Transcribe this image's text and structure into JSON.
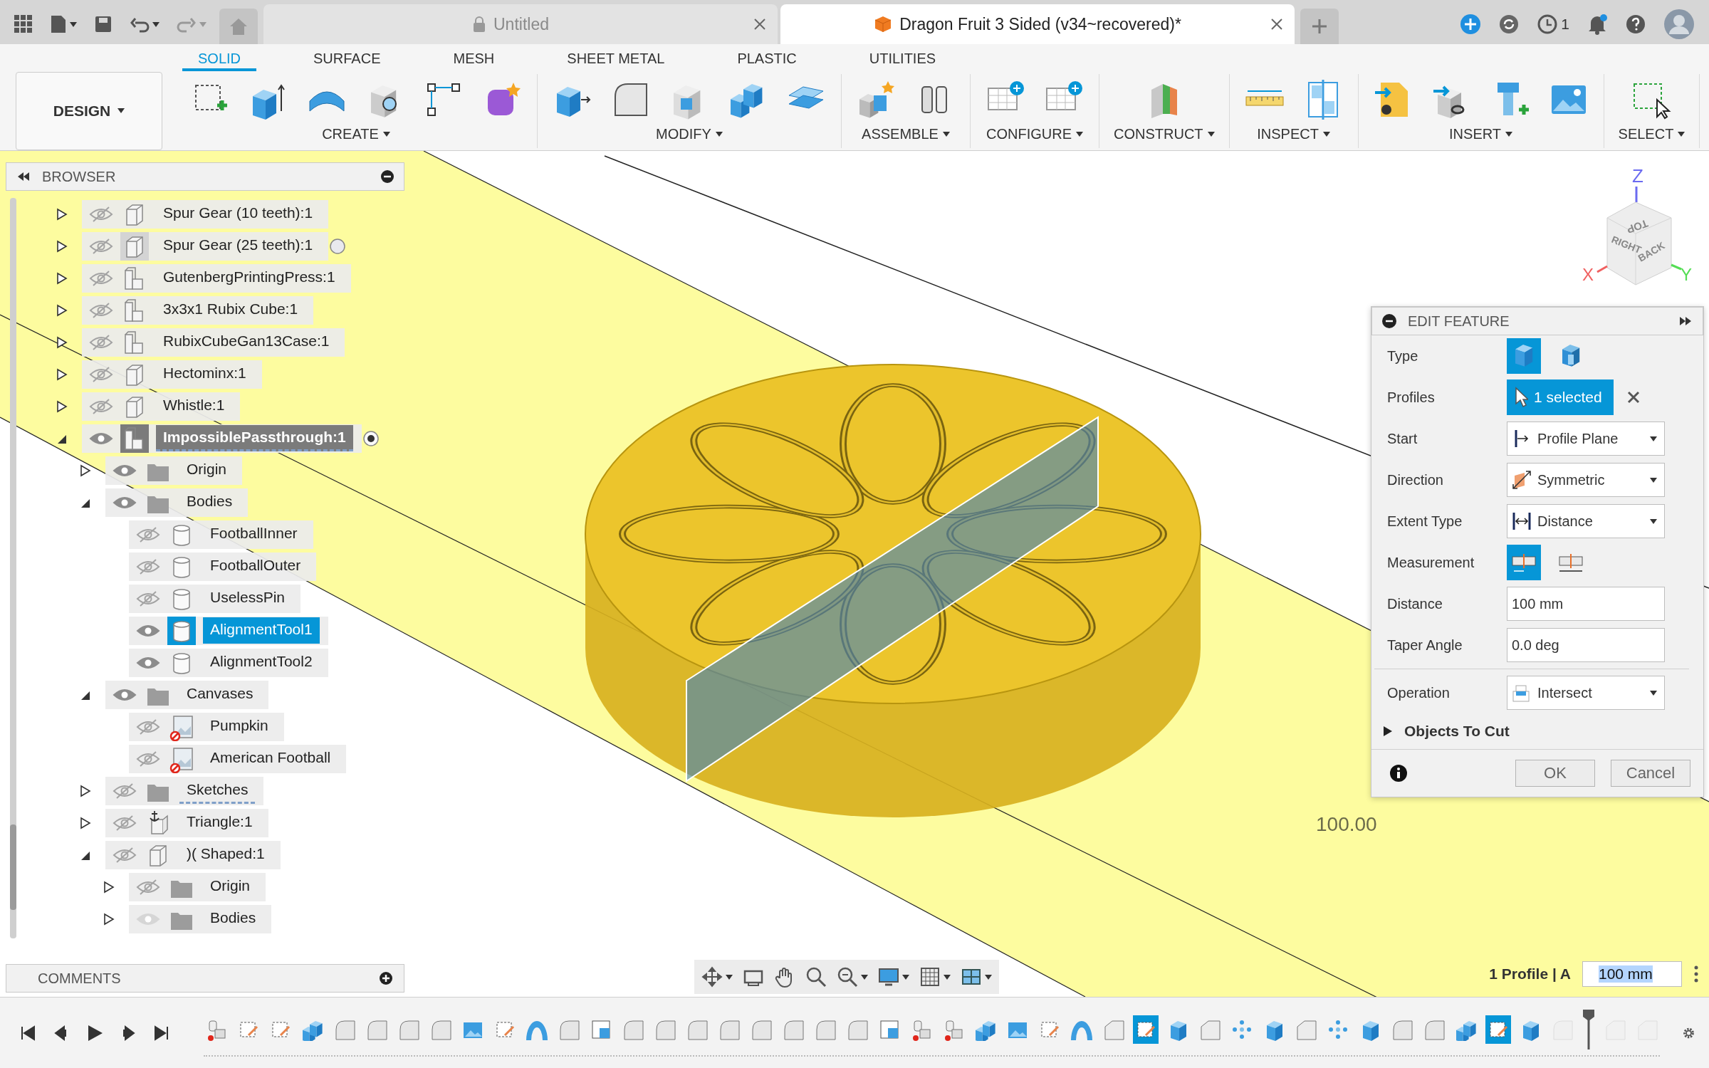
{
  "title_bar": {
    "tabs": [
      {
        "label": "Untitled",
        "selected": false,
        "locked": true
      },
      {
        "label": "Dragon Fruit 3 Sided (v34~recovered)*",
        "selected": true,
        "locked": false
      }
    ],
    "jobs_count": "1",
    "notification_dot": true
  },
  "workspace": {
    "label": "DESIGN"
  },
  "ribbon_tabs": [
    {
      "label": "SOLID",
      "selected": true
    },
    {
      "label": "SURFACE",
      "selected": false
    },
    {
      "label": "MESH",
      "selected": false
    },
    {
      "label": "SHEET METAL",
      "selected": false
    },
    {
      "label": "PLASTIC",
      "selected": false
    },
    {
      "label": "UTILITIES",
      "selected": false
    }
  ],
  "tool_groups": [
    {
      "label": "CREATE"
    },
    {
      "label": "MODIFY"
    },
    {
      "label": "ASSEMBLE"
    },
    {
      "label": "CONFIGURE"
    },
    {
      "label": "CONSTRUCT"
    },
    {
      "label": "INSPECT"
    },
    {
      "label": "INSERT"
    },
    {
      "label": "SELECT"
    }
  ],
  "browser": {
    "title": "BROWSER",
    "items": [
      {
        "label": "Spur Gear (10 teeth):1",
        "kind": "part",
        "visible": false,
        "expanded": false,
        "selected": false
      },
      {
        "label": "Spur Gear (25 teeth):1",
        "kind": "part",
        "visible": false,
        "expanded": false,
        "selected": false,
        "hovered": true,
        "activated": false
      },
      {
        "label": "GutenbergPrintingPress:1",
        "kind": "assembly",
        "visible": false,
        "expanded": false,
        "selected": false
      },
      {
        "label": "3x3x1 Rubix Cube:1",
        "kind": "assembly",
        "visible": false,
        "expanded": false,
        "selected": false
      },
      {
        "label": "RubixCubeGan13Case:1",
        "kind": "assembly",
        "visible": false,
        "expanded": false,
        "selected": false
      },
      {
        "label": "Hectominx:1",
        "kind": "part",
        "visible": false,
        "expanded": false,
        "selected": false
      },
      {
        "label": "Whistle:1",
        "kind": "part",
        "visible": false,
        "expanded": false,
        "selected": false
      },
      {
        "label": "ImpossiblePassthrough:1",
        "kind": "assembly",
        "visible": true,
        "expanded": true,
        "selected": false,
        "active": true,
        "activated": true,
        "underlined": true,
        "children": [
          {
            "label": "Origin",
            "kind": "folder",
            "visible": true,
            "expanded": false,
            "selected": false
          },
          {
            "label": "Bodies",
            "kind": "folder",
            "visible": true,
            "expanded": true,
            "selected": false,
            "children": [
              {
                "label": "FootballInner",
                "kind": "body",
                "visible": false,
                "selected": false
              },
              {
                "label": "FootballOuter",
                "kind": "body",
                "visible": false,
                "selected": false
              },
              {
                "label": "UselessPin",
                "kind": "body",
                "visible": false,
                "selected": false
              },
              {
                "label": "AlignmentTool1",
                "kind": "body",
                "visible": true,
                "selected": true
              },
              {
                "label": "AlignmentTool2",
                "kind": "body",
                "visible": true,
                "selected": false
              }
            ]
          },
          {
            "label": "Canvases",
            "kind": "folder",
            "visible": true,
            "expanded": true,
            "selected": false,
            "children": [
              {
                "label": "Pumpkin",
                "kind": "canvas",
                "visible": false,
                "selected": false
              },
              {
                "label": "American Football",
                "kind": "canvas",
                "visible": false,
                "selected": false
              }
            ]
          },
          {
            "label": "Sketches",
            "kind": "folder",
            "visible": false,
            "expanded": false,
            "selected": false,
            "underlined": true
          },
          {
            "label": "Triangle:1",
            "kind": "grounded",
            "visible": false,
            "expanded": false,
            "selected": false
          },
          {
            "label": ")( Shaped:1",
            "kind": "part",
            "visible": false,
            "expanded": true,
            "selected": false,
            "children": [
              {
                "label": "Origin",
                "kind": "folder",
                "visible": false,
                "expanded": false,
                "selected": false
              },
              {
                "label": "Bodies",
                "kind": "folder",
                "visible": true,
                "dimmed": true,
                "expanded": false,
                "selected": false
              }
            ]
          }
        ]
      }
    ]
  },
  "viewport": {
    "dimension": "100.00",
    "viewcube": {
      "top": "TOP",
      "right": "RIGHT",
      "back": "BACK"
    },
    "axes": {
      "x": "X",
      "y": "Y",
      "z": "Z"
    }
  },
  "edit_feature": {
    "title": "EDIT FEATURE",
    "rows": [
      {
        "kind": "toggle",
        "label": "Type",
        "options": [
          {
            "selected": true
          },
          {
            "selected": false
          }
        ]
      },
      {
        "kind": "selection",
        "label": "Profiles",
        "value": "1 selected"
      },
      {
        "kind": "dropdown",
        "label": "Start",
        "value": "Profile Plane"
      },
      {
        "kind": "dropdown",
        "label": "Direction",
        "value": "Symmetric"
      },
      {
        "kind": "dropdown",
        "label": "Extent Type",
        "value": "Distance"
      },
      {
        "kind": "toggle",
        "label": "Measurement",
        "options": [
          {
            "selected": true
          },
          {
            "selected": false
          }
        ]
      },
      {
        "kind": "input",
        "label": "Distance",
        "value": "100 mm"
      },
      {
        "kind": "input",
        "label": "Taper Angle",
        "value": "0.0 deg"
      },
      {
        "kind": "dropdown",
        "label": "Operation",
        "value": "Intersect",
        "divided": true
      }
    ],
    "objects_to_cut": {
      "label": "Objects To Cut",
      "expanded": false
    },
    "buttons": [
      "OK",
      "Cancel"
    ]
  },
  "comments": {
    "title": "COMMENTS"
  },
  "status": {
    "selection": "1 Profile | A",
    "value": "100 mm"
  },
  "timeline": {
    "items": [
      {
        "kind": "joint",
        "selected": false,
        "rolled_back": false
      },
      {
        "kind": "sketch",
        "selected": false,
        "rolled_back": false
      },
      {
        "kind": "sketch",
        "selected": false,
        "rolled_back": false
      },
      {
        "kind": "combine",
        "selected": false,
        "rolled_back": false
      },
      {
        "kind": "fillet",
        "selected": false,
        "rolled_back": false
      },
      {
        "kind": "fillet",
        "selected": false,
        "rolled_back": false
      },
      {
        "kind": "fillet",
        "selected": false,
        "rolled_back": false
      },
      {
        "kind": "fillet",
        "selected": false,
        "rolled_back": false
      },
      {
        "kind": "canvas",
        "selected": false,
        "rolled_back": false
      },
      {
        "kind": "sketch",
        "selected": false,
        "rolled_back": false
      },
      {
        "kind": "surface",
        "selected": false,
        "rolled_back": false
      },
      {
        "kind": "fillet",
        "selected": false,
        "rolled_back": false
      },
      {
        "kind": "box",
        "selected": false,
        "rolled_back": false
      },
      {
        "kind": "fillet",
        "selected": false,
        "rolled_back": false
      },
      {
        "kind": "fillet",
        "selected": false,
        "rolled_back": false
      },
      {
        "kind": "fillet",
        "selected": false,
        "rolled_back": false
      },
      {
        "kind": "fillet",
        "selected": false,
        "rolled_back": false
      },
      {
        "kind": "fillet",
        "selected": false,
        "rolled_back": false
      },
      {
        "kind": "fillet",
        "selected": false,
        "rolled_back": false
      },
      {
        "kind": "fillet",
        "selected": false,
        "rolled_back": false
      },
      {
        "kind": "fillet",
        "selected": false,
        "rolled_back": false
      },
      {
        "kind": "box",
        "selected": false,
        "rolled_back": false
      },
      {
        "kind": "joint",
        "selected": false,
        "rolled_back": false
      },
      {
        "kind": "joint",
        "selected": false,
        "rolled_back": false
      },
      {
        "kind": "combine",
        "selected": false,
        "rolled_back": false
      },
      {
        "kind": "canvas",
        "selected": false,
        "rolled_back": false
      },
      {
        "kind": "sketch",
        "selected": false,
        "rolled_back": false
      },
      {
        "kind": "surface",
        "selected": false,
        "rolled_back": false
      },
      {
        "kind": "chamfer",
        "selected": false,
        "rolled_back": false
      },
      {
        "kind": "sketch",
        "selected": true,
        "rolled_back": false
      },
      {
        "kind": "extrude",
        "selected": false,
        "rolled_back": false
      },
      {
        "kind": "chamfer",
        "selected": false,
        "rolled_back": false
      },
      {
        "kind": "pattern",
        "selected": false,
        "rolled_back": false
      },
      {
        "kind": "extrude",
        "selected": false,
        "rolled_back": false
      },
      {
        "kind": "chamfer",
        "selected": false,
        "rolled_back": false
      },
      {
        "kind": "pattern",
        "selected": false,
        "rolled_back": false
      },
      {
        "kind": "extrude",
        "selected": false,
        "rolled_back": false
      },
      {
        "kind": "fillet",
        "selected": false,
        "rolled_back": false
      },
      {
        "kind": "fillet",
        "selected": false,
        "rolled_back": false
      },
      {
        "kind": "combine",
        "selected": false,
        "rolled_back": false
      },
      {
        "kind": "sketch",
        "selected": true,
        "rolled_back": false
      },
      {
        "kind": "extrude",
        "selected": false,
        "rolled_back": false
      },
      {
        "kind": "fillet",
        "selected": false,
        "rolled_back": true
      },
      {
        "kind": "marker"
      },
      {
        "kind": "chamfer",
        "selected": false,
        "rolled_back": true
      },
      {
        "kind": "chamfer",
        "selected": false,
        "rolled_back": true
      }
    ]
  }
}
